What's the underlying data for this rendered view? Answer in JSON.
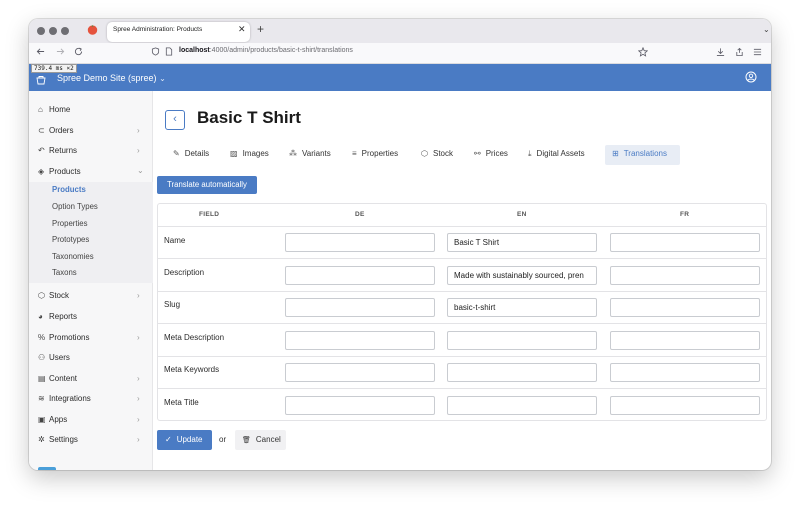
{
  "browser": {
    "tab_title": "Spree Administration: Products",
    "tab_close": "✕",
    "new_tab": "+",
    "tab_list": "⌄",
    "url_host": "localhost",
    "url_rest": ":4000/admin/products/basic-t-shirt/translations",
    "perf": "739.4 ms ×2"
  },
  "header": {
    "store_name": "Spree Demo Site (spree)",
    "store_chevron": "⌄"
  },
  "sidebar": {
    "items": [
      {
        "label": "Home",
        "icon": "⌂",
        "chevron": ""
      },
      {
        "label": "Orders",
        "icon": "⊂",
        "chevron": "›"
      },
      {
        "label": "Returns",
        "icon": "↶",
        "chevron": "›"
      },
      {
        "label": "Products",
        "icon": "◈",
        "chevron": "⌄"
      },
      {
        "label": "Stock",
        "icon": "⬡",
        "chevron": "›"
      },
      {
        "label": "Reports",
        "icon": "◕",
        "chevron": ""
      },
      {
        "label": "Promotions",
        "icon": "%",
        "chevron": "›"
      },
      {
        "label": "Users",
        "icon": "⚇",
        "chevron": ""
      },
      {
        "label": "Content",
        "icon": "▤",
        "chevron": "›"
      },
      {
        "label": "Integrations",
        "icon": "≋",
        "chevron": "›"
      },
      {
        "label": "Apps",
        "icon": "▣",
        "chevron": "›"
      },
      {
        "label": "Settings",
        "icon": "✲",
        "chevron": "›"
      }
    ],
    "sub_items": [
      "Products",
      "Option Types",
      "Properties",
      "Prototypes",
      "Taxonomies",
      "Taxons"
    ]
  },
  "page": {
    "back": "‹",
    "title": "Basic T Shirt",
    "translate_button": "Translate automatically",
    "tabs": [
      {
        "label": "Details",
        "icon": "✎"
      },
      {
        "label": "Images",
        "icon": "▨"
      },
      {
        "label": "Variants",
        "icon": "⁂"
      },
      {
        "label": "Properties",
        "icon": "≡"
      },
      {
        "label": "Stock",
        "icon": "⬡"
      },
      {
        "label": "Prices",
        "icon": "⚯"
      },
      {
        "label": "Digital Assets",
        "icon": "⤓"
      },
      {
        "label": "Translations",
        "icon": "⊞"
      }
    ]
  },
  "table": {
    "columns": [
      "FIELD",
      "DE",
      "EN",
      "FR"
    ],
    "rows": [
      {
        "field": "Name",
        "de": "",
        "en": "Basic T Shirt",
        "fr": ""
      },
      {
        "field": "Description",
        "de": "",
        "en": "Made with sustainably sourced, pren",
        "fr": ""
      },
      {
        "field": "Slug",
        "de": "",
        "en": "basic-t-shirt",
        "fr": ""
      },
      {
        "field": "Meta Description",
        "de": "",
        "en": "",
        "fr": ""
      },
      {
        "field": "Meta Keywords",
        "de": "",
        "en": "",
        "fr": ""
      },
      {
        "field": "Meta Title",
        "de": "",
        "en": "",
        "fr": ""
      }
    ]
  },
  "footer": {
    "update_icon": "✓",
    "update_label": "Update",
    "or_text": "or",
    "cancel_icon": "🗑",
    "cancel_label": "Cancel"
  },
  "colors": {
    "accent": "#4a7bc4",
    "header_bg": "#4a7bc4",
    "sidebar_bg": "#f7f7f8"
  }
}
